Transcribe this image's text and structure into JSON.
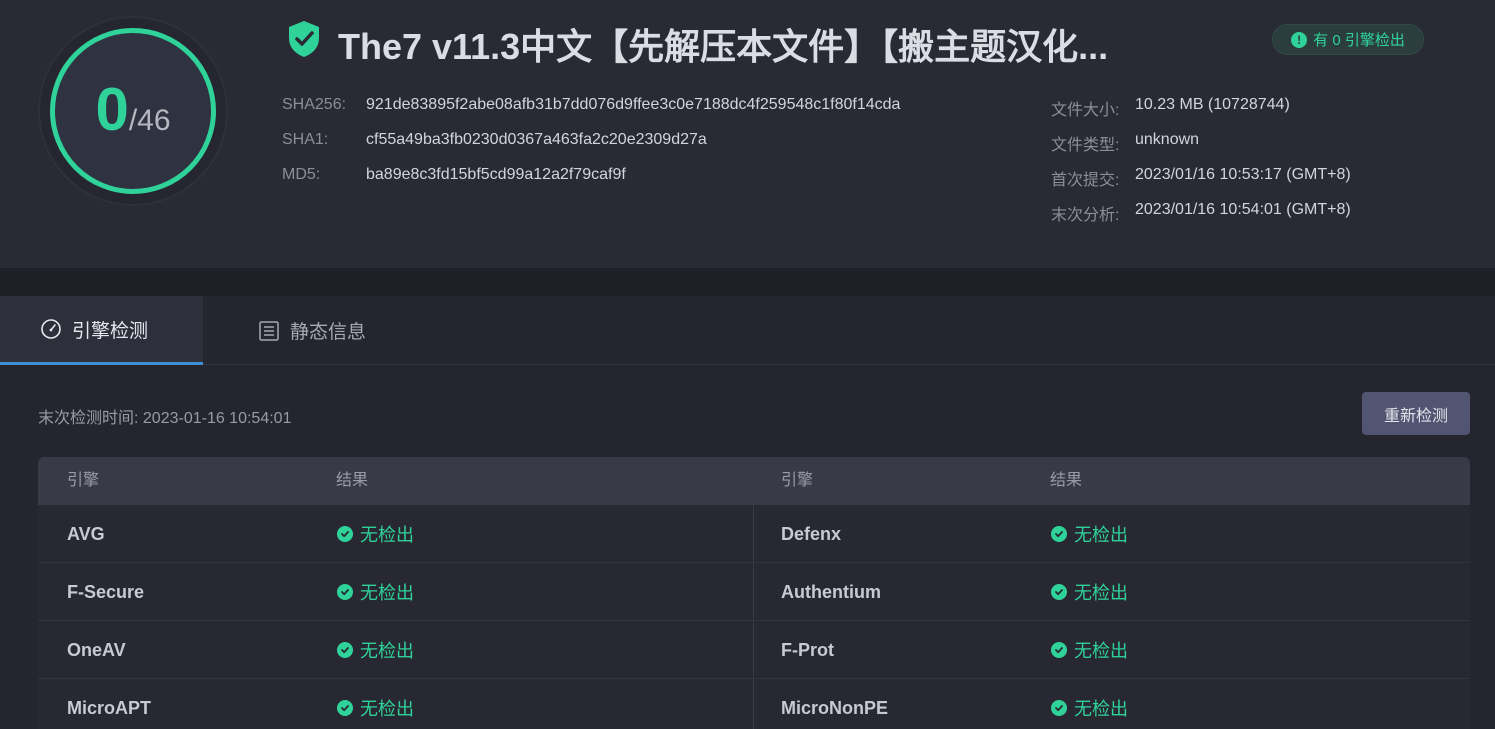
{
  "score": {
    "detected": "0",
    "total": "/46"
  },
  "file": {
    "title": "The7 v11.3中文【先解压本文件】【搬主题汉化...",
    "badge": "有 0 引擎检出",
    "hashes": [
      {
        "label": "SHA256:",
        "value": "921de83895f2abe08afb31b7dd076d9ffee3c0e7188dc4f259548c1f80f14cda"
      },
      {
        "label": "SHA1:",
        "value": "cf55a49ba3fb0230d0367a463fa2c20e2309d27a"
      },
      {
        "label": "MD5:",
        "value": "ba89e8c3fd15bf5cd99a12a2f79caf9f"
      }
    ],
    "info": [
      {
        "label": "文件大小:",
        "value": "10.23 MB (10728744)"
      },
      {
        "label": "文件类型:",
        "value": "unknown"
      },
      {
        "label": "首次提交:",
        "value": "2023/01/16 10:53:17 (GMT+8)"
      },
      {
        "label": "末次分析:",
        "value": "2023/01/16 10:54:01 (GMT+8)"
      }
    ]
  },
  "tabs": {
    "engine": "引擎检测",
    "static": "静态信息"
  },
  "scan": {
    "last_scan": "末次检测时间: 2023-01-16 10:54:01",
    "rescan_label": "重新检测"
  },
  "table": {
    "headers": {
      "engine": "引擎",
      "result": "结果"
    },
    "rows": [
      {
        "left_engine": "AVG",
        "left_result": "无检出",
        "right_engine": "Defenx",
        "right_result": "无检出"
      },
      {
        "left_engine": "F-Secure",
        "left_result": "无检出",
        "right_engine": "Authentium",
        "right_result": "无检出"
      },
      {
        "left_engine": "OneAV",
        "left_result": "无检出",
        "right_engine": "F-Prot",
        "right_result": "无检出"
      },
      {
        "left_engine": "MicroAPT",
        "left_result": "无检出",
        "right_engine": "MicroNonPE",
        "right_result": "无检出"
      }
    ]
  },
  "colors": {
    "accent": "#2fd39a",
    "tab_indicator": "#3f8fd6"
  }
}
